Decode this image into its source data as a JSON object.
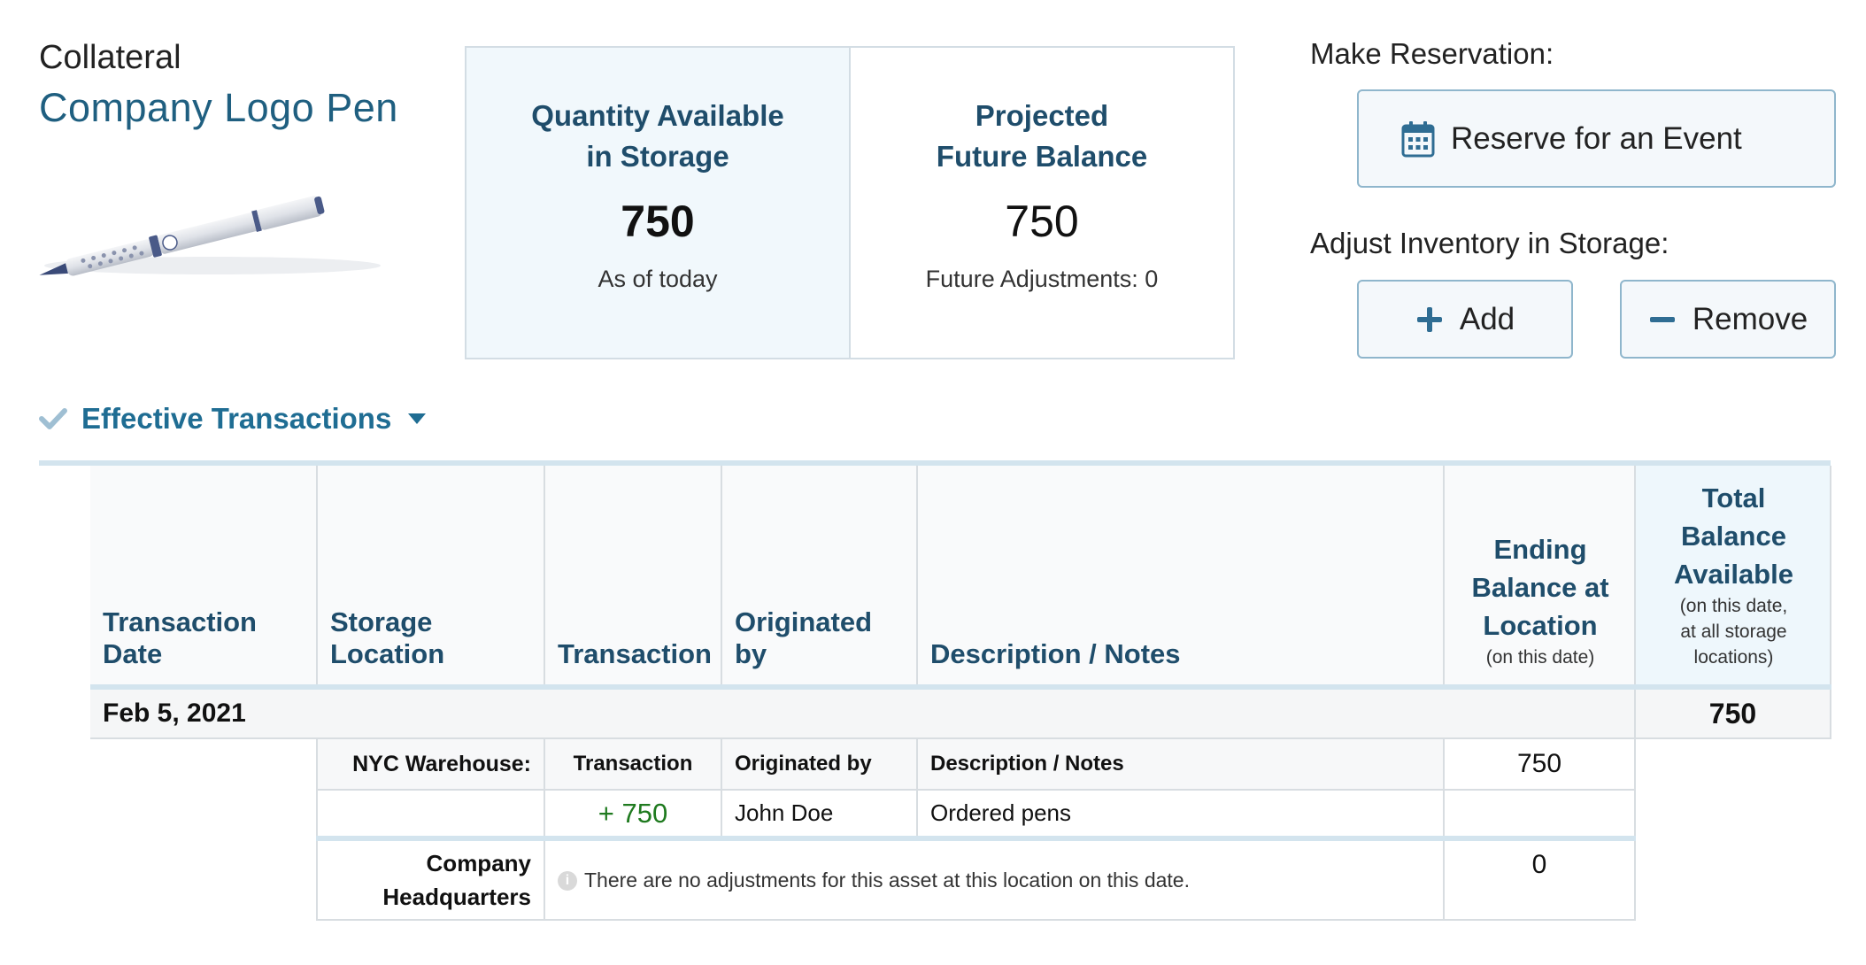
{
  "product": {
    "category": "Collateral",
    "name": "Company Logo Pen"
  },
  "stats": {
    "available": {
      "title_line1": "Quantity Available",
      "title_line2": "in Storage",
      "value": "750",
      "caption": "As of today"
    },
    "projected": {
      "title_line1": "Projected",
      "title_line2": "Future Balance",
      "value": "750",
      "caption": "Future Adjustments: 0"
    }
  },
  "actions": {
    "reservation_heading": "Make Reservation:",
    "reserve_label": "Reserve for an Event",
    "adjust_heading": "Adjust Inventory in Storage:",
    "add_label": "Add",
    "remove_label": "Remove"
  },
  "section": {
    "title": "Effective Transactions"
  },
  "table": {
    "headers": {
      "date": "Transaction Date",
      "location": "Storage Location",
      "transaction": "Transaction",
      "originated": "Originated by",
      "description": "Description / Notes",
      "ending_line1": "Ending",
      "ending_line2": "Balance at",
      "ending_line3": "Location",
      "ending_sub": "(on this date)",
      "total_line1": "Total",
      "total_line2": "Balance",
      "total_line3": "Available",
      "total_sub1": "(on this date,",
      "total_sub2": "at all storage",
      "total_sub3": "locations)"
    },
    "date_group": {
      "date": "Feb 5, 2021",
      "total": "750"
    },
    "locations": [
      {
        "name": "NYC Warehouse:",
        "sub_headers": {
          "transaction": "Transaction",
          "originated": "Originated by",
          "description": "Description / Notes"
        },
        "ending_balance": "750",
        "entries": [
          {
            "amount": "+ 750",
            "originated_by": "John Doe",
            "notes": "Ordered pens"
          }
        ]
      },
      {
        "name_line1": "Company",
        "name_line2": "Headquarters",
        "message": "There are no adjustments for this asset at this location on this date.",
        "ending_balance": "0"
      }
    ]
  },
  "colors": {
    "accent": "#1f6d93",
    "heading": "#1f4d6b",
    "positive": "#1f7a1f",
    "button_border": "#8fb6cc"
  },
  "icons": [
    "pen-image",
    "calendar-icon",
    "plus-icon",
    "minus-icon",
    "check-icon",
    "caret-down-icon",
    "info-icon"
  ]
}
